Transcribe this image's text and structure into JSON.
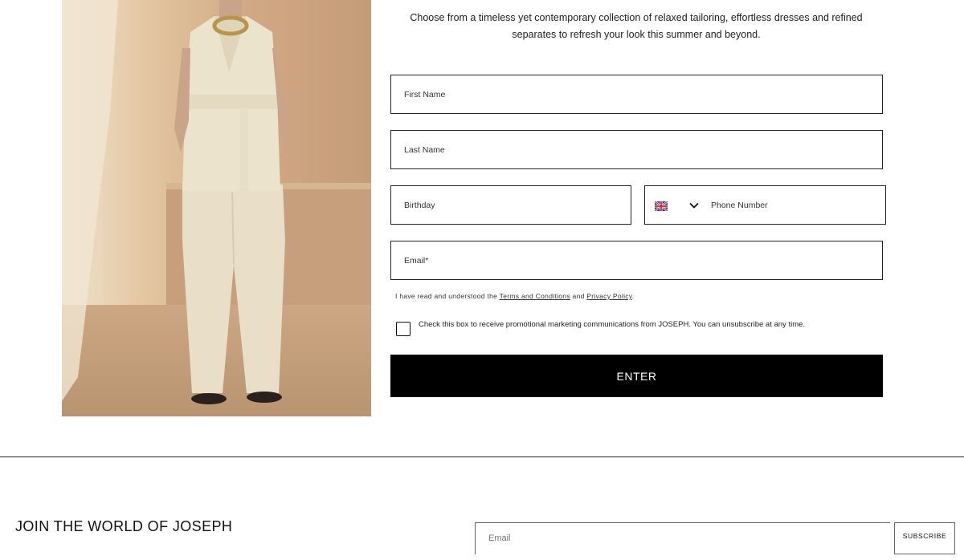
{
  "intro": {
    "line1": "Choose from a timeless yet contemporary collection of relaxed tailoring, effortless dresses and refined",
    "line2": "separates to refresh your look this summer and beyond."
  },
  "form": {
    "first_name_placeholder": "First Name",
    "last_name_placeholder": "Last Name",
    "birthday_placeholder": "Birthday",
    "phone_placeholder": "Phone Number",
    "phone_country_icon": "uk-flag-icon",
    "email_placeholder": "Email*",
    "terms": {
      "prefix": "I have read and understood the ",
      "terms_link": "Terms and Conditions",
      "middle": " and ",
      "privacy_link": "Privacy Policy",
      "suffix": "."
    },
    "consent_text": "Check this box to receive promotional marketing communications from JOSEPH. You can unsubscribe at any time.",
    "consent_checked": false,
    "submit_label": "ENTER"
  },
  "footer": {
    "title": "JOIN THE WORLD OF JOSEPH",
    "email_placeholder": "Email",
    "subscribe_label": "SUBSCRIBE"
  },
  "colors": {
    "button_bg": "#000000",
    "border": "#222222",
    "text": "#111111"
  }
}
